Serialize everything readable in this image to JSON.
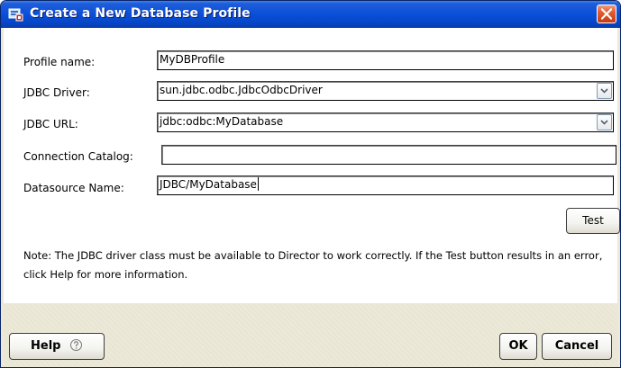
{
  "window": {
    "title": "Create a New Database Profile",
    "accent": "#0a4fd8"
  },
  "form": {
    "profile_name": {
      "label": "Profile name:",
      "value": "MyDBProfile"
    },
    "jdbc_driver": {
      "label": "JDBC Driver:",
      "value": "sun.jdbc.odbc.JdbcOdbcDriver"
    },
    "jdbc_url": {
      "label": "JDBC URL:",
      "value": "jdbc:odbc:MyDatabase"
    },
    "connection_catalog": {
      "label": "Connection Catalog:",
      "value": ""
    },
    "datasource_name": {
      "label": "Datasource Name:",
      "value": "JDBC/MyDatabase"
    }
  },
  "buttons": {
    "test": "Test",
    "help": "Help",
    "ok": "OK",
    "cancel": "Cancel"
  },
  "note": "Note: The JDBC driver class must be available to Director to work correctly. If the Test button results in an error, click Help for more information.",
  "icons": {
    "app": "database-profile-icon",
    "close": "close-icon",
    "help": "help-circle-icon",
    "dropdown": "chevron-down-icon"
  }
}
